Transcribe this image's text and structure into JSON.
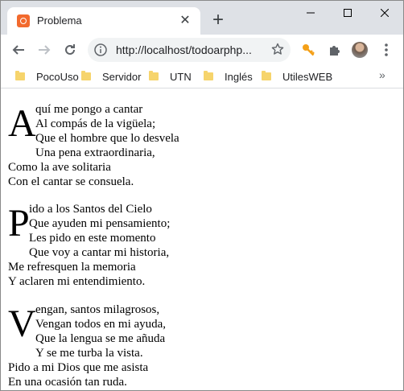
{
  "tab": {
    "title": "Problema"
  },
  "address_bar": {
    "url": "http://localhost/todoarphp..."
  },
  "bookmarks": [
    "PocoUso",
    "Servidor",
    "UTN",
    "Inglés",
    "UtilesWEB"
  ],
  "poem": {
    "stanzas": [
      {
        "initial": "A",
        "lines": [
          "quí me pongo a cantar",
          "Al compás de la vigüela;",
          "Que el hombre que lo desvela",
          "Una pena extraordinaria,",
          "Como la ave solitaria",
          "Con el cantar se consuela."
        ]
      },
      {
        "initial": "P",
        "lines": [
          "ido a los Santos del Cielo",
          "Que ayuden mi pensamiento;",
          "Les pido en este momento",
          "Que voy a cantar mi historia,",
          "Me refresquen la memoria",
          "Y aclaren mi entendimiento."
        ]
      },
      {
        "initial": "V",
        "lines": [
          "engan, santos milagrosos,",
          "Vengan todos en mi ayuda,",
          "Que la lengua se me añuda",
          "Y se me turba la vista.",
          "Pido a mi Dios que me asista",
          "En una ocasión tan ruda."
        ]
      }
    ]
  },
  "icons": {
    "favicon": "xampp-icon",
    "ext1": "key-icon",
    "ext2": "puzzle-icon",
    "accent": "#f4a018"
  }
}
